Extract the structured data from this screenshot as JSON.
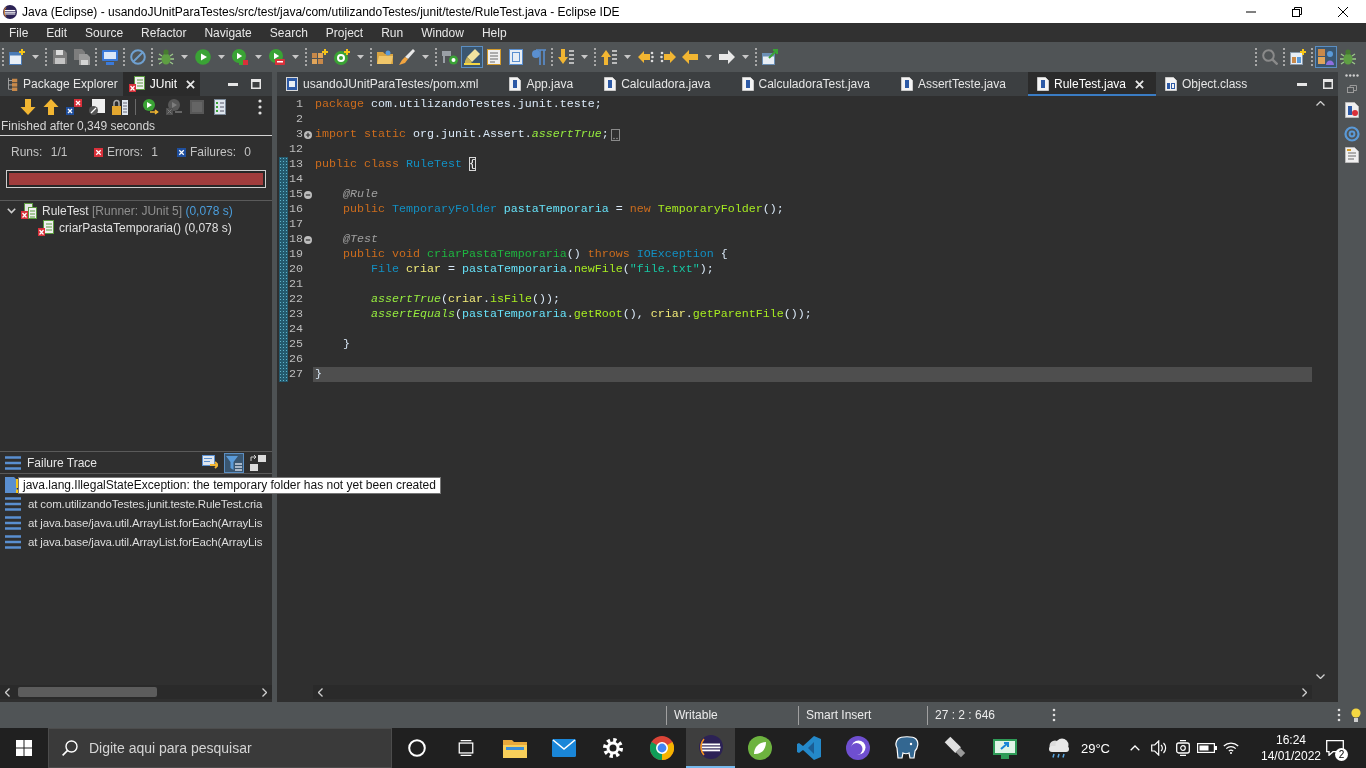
{
  "window": {
    "title": "Java (Eclipse) - usandoJUnitParaTestes/src/test/java/com/utilizandoTestes/junit/teste/RuleTest.java - Eclipse IDE"
  },
  "menu": [
    "File",
    "Edit",
    "Source",
    "Refactor",
    "Navigate",
    "Search",
    "Project",
    "Run",
    "Window",
    "Help"
  ],
  "toolbar": {
    "groups": [
      {
        "items": [
          {
            "kind": "new-wizard",
            "dropdown": true,
            "pressed": false
          }
        ]
      },
      {
        "items": [
          {
            "kind": "save",
            "dropdown": false,
            "pressed": false
          },
          {
            "kind": "save-all",
            "dropdown": false,
            "pressed": false
          }
        ]
      },
      {
        "items": [
          {
            "kind": "terminal",
            "dropdown": false,
            "pressed": false
          }
        ]
      },
      {
        "items": [
          {
            "kind": "skip-breakpoints",
            "dropdown": false,
            "pressed": false
          }
        ]
      },
      {
        "items": [
          {
            "kind": "debug",
            "dropdown": true,
            "pressed": false
          },
          {
            "kind": "run",
            "dropdown": true,
            "pressed": false
          },
          {
            "kind": "coverage",
            "dropdown": true,
            "pressed": false
          },
          {
            "kind": "external-tools",
            "dropdown": true,
            "pressed": false
          }
        ]
      },
      {
        "items": [
          {
            "kind": "new-package",
            "dropdown": false,
            "pressed": false
          },
          {
            "kind": "new-class",
            "dropdown": true,
            "pressed": false
          }
        ]
      },
      {
        "items": [
          {
            "kind": "open-type",
            "dropdown": false,
            "pressed": false
          },
          {
            "kind": "brush",
            "dropdown": true,
            "pressed": false
          }
        ]
      },
      {
        "items": [
          {
            "kind": "breadcrumb",
            "dropdown": false,
            "pressed": false
          },
          {
            "kind": "highlight",
            "dropdown": false,
            "pressed": true
          },
          {
            "kind": "block-selection",
            "dropdown": false,
            "pressed": false
          },
          {
            "kind": "show-whitespace",
            "dropdown": false,
            "pressed": false
          },
          {
            "kind": "pilcrow",
            "dropdown": false,
            "pressed": false
          }
        ]
      },
      {
        "items": [
          {
            "kind": "next-annotation",
            "dropdown": true,
            "pressed": false
          }
        ]
      },
      {
        "items": [
          {
            "kind": "previous-annotation",
            "dropdown": true,
            "pressed": false
          },
          {
            "kind": "last-edit",
            "dropdown": false,
            "pressed": false
          },
          {
            "kind": "next-edit",
            "dropdown": false,
            "pressed": false
          },
          {
            "kind": "back",
            "dropdown": true,
            "pressed": false
          },
          {
            "kind": "forward",
            "dropdown": true,
            "pressed": false
          }
        ]
      },
      {
        "items": [
          {
            "kind": "launch",
            "dropdown": false,
            "pressed": false
          }
        ]
      }
    ],
    "right_groups": [
      {
        "items": [
          {
            "kind": "search",
            "dropdown": false,
            "pressed": false
          }
        ]
      },
      {
        "items": [
          {
            "kind": "open-perspective",
            "dropdown": false,
            "pressed": false
          }
        ]
      },
      {
        "items": [
          {
            "kind": "java-perspective",
            "dropdown": false,
            "pressed": true
          },
          {
            "kind": "debug-perspective",
            "dropdown": false,
            "pressed": false
          }
        ]
      }
    ]
  },
  "left_panel": {
    "tabs": [
      {
        "label": "Package Explorer",
        "kind": "explorer",
        "selected": false
      },
      {
        "label": "JUnit",
        "kind": "junit",
        "selected": true
      }
    ],
    "toolbar": {
      "groups": [
        {
          "items": [
            {
              "kind": "next-failure",
              "disabled": false
            },
            {
              "kind": "previous-failure",
              "disabled": false
            },
            {
              "kind": "failures-only",
              "disabled": false
            },
            {
              "kind": "skipped-filter",
              "disabled": false
            },
            {
              "kind": "scroll-lock",
              "disabled": false
            }
          ]
        },
        {
          "items": [
            {
              "kind": "rerun",
              "disabled": false
            },
            {
              "kind": "rerun-failed",
              "disabled": true
            },
            {
              "kind": "stop",
              "disabled": true
            },
            {
              "kind": "history",
              "disabled": false
            }
          ]
        },
        {
          "items": [
            {
              "kind": "view-menu",
              "disabled": false
            }
          ]
        }
      ]
    },
    "status": "Finished after 0,349 seconds",
    "counters": [
      {
        "kind": "runs",
        "label": "Runs:",
        "value": "1/1"
      },
      {
        "kind": "errors",
        "label": "Errors:",
        "value": "1"
      },
      {
        "kind": "failures",
        "label": "Failures:",
        "value": "0"
      }
    ],
    "progress": {
      "level": 1,
      "failed": true
    },
    "tests": [
      {
        "kind": "suite",
        "name": "RuleTest",
        "runner": "[Runner: JUnit 5]",
        "time": "(0,078 s)",
        "failed": true,
        "expanded": true,
        "children": [
          {
            "kind": "test",
            "name": "criarPastaTemporaria()",
            "time": "(0,078 s)",
            "failed": true
          }
        ]
      }
    ],
    "failure_trace": {
      "title": "Failure Trace",
      "tools": [
        {
          "kind": "compare",
          "pressed": false
        },
        {
          "kind": "filter",
          "pressed": true
        },
        {
          "kind": "layout",
          "pressed": false
        }
      ],
      "lines": [
        {
          "kind": "exception"
        },
        {
          "kind": "frame",
          "text": "at com.utilizandoTestes.junit.teste.RuleTest.cria"
        },
        {
          "kind": "frame",
          "text": "at java.base/java.util.ArrayList.forEach(ArrayLis"
        },
        {
          "kind": "frame",
          "text": "at java.base/java.util.ArrayList.forEach(ArrayLis"
        }
      ]
    },
    "tooltip": "java.lang.IllegalStateException: the temporary folder has not yet been created"
  },
  "editor": {
    "tabs": [
      {
        "label": "usandoJUnitParaTestes/pom.xml",
        "kind": "maven",
        "selected": false
      },
      {
        "label": "App.java",
        "kind": "java",
        "selected": false
      },
      {
        "label": "Calculadora.java",
        "kind": "java",
        "selected": false
      },
      {
        "label": "CalculadoraTest.java",
        "kind": "java",
        "selected": false
      },
      {
        "label": "AssertTeste.java",
        "kind": "java",
        "selected": false
      },
      {
        "label": "RuleTest.java",
        "kind": "java",
        "selected": true
      },
      {
        "label": "Object.class",
        "kind": "class",
        "selected": false
      }
    ],
    "lines": [
      {
        "number": "1",
        "fold_start": false,
        "changed": false,
        "current": false,
        "tokens": [
          {
            "kind": "keyword",
            "text": "package"
          },
          {
            "kind": "plain",
            "text": " com.utilizandoTestes.junit.teste;"
          }
        ]
      },
      {
        "number": "2",
        "fold_start": false,
        "changed": false,
        "current": false
      },
      {
        "number": "3",
        "fold_start": true,
        "collapsed": true,
        "changed": false,
        "current": false,
        "tokens": [
          {
            "kind": "keyword",
            "text": "import static"
          },
          {
            "kind": "plain",
            "text": " org.junit.Assert."
          },
          {
            "kind": "static",
            "text": "assertTrue"
          },
          {
            "kind": "plain",
            "text": ";"
          }
        ]
      },
      {
        "number": "12",
        "fold_start": false,
        "changed": false,
        "current": false
      },
      {
        "number": "13",
        "fold_start": false,
        "changed": true,
        "current": false,
        "tokens": [
          {
            "kind": "keyword",
            "text": "public class"
          },
          {
            "kind": "type",
            "text": " RuleTest "
          },
          {
            "kind": "bracket-match",
            "text": "{"
          }
        ]
      },
      {
        "number": "14",
        "fold_start": false,
        "changed": true,
        "current": false
      },
      {
        "number": "15",
        "fold_start": true,
        "collapsed": false,
        "changed": true,
        "current": false,
        "tokens": [
          {
            "kind": "annotation",
            "text": "    @Rule"
          }
        ]
      },
      {
        "number": "16",
        "fold_start": false,
        "changed": true,
        "current": false,
        "tokens": [
          {
            "kind": "keyword",
            "text": "    public"
          },
          {
            "kind": "type",
            "text": " TemporaryFolder"
          },
          {
            "kind": "field",
            "text": " pastaTemporaria"
          },
          {
            "kind": "plain",
            "text": " = "
          },
          {
            "kind": "keyword",
            "text": "new"
          },
          {
            "kind": "method",
            "text": " TemporaryFolder"
          },
          {
            "kind": "plain",
            "text": "();"
          }
        ]
      },
      {
        "number": "17",
        "fold_start": false,
        "changed": true,
        "current": false
      },
      {
        "number": "18",
        "fold_start": true,
        "collapsed": false,
        "changed": true,
        "current": false,
        "tokens": [
          {
            "kind": "annotation",
            "text": "    @Test"
          }
        ]
      },
      {
        "number": "19",
        "fold_start": false,
        "changed": true,
        "current": false,
        "tokens": [
          {
            "kind": "keyword",
            "text": "    public void"
          },
          {
            "kind": "method-decl",
            "text": " criarPastaTemporaria"
          },
          {
            "kind": "plain",
            "text": "() "
          },
          {
            "kind": "keyword",
            "text": "throws"
          },
          {
            "kind": "type",
            "text": " IOException"
          },
          {
            "kind": "plain",
            "text": " {"
          }
        ]
      },
      {
        "number": "20",
        "fold_start": false,
        "changed": true,
        "current": false,
        "tokens": [
          {
            "kind": "type",
            "text": "        File"
          },
          {
            "kind": "local",
            "text": " criar"
          },
          {
            "kind": "plain",
            "text": " = "
          },
          {
            "kind": "field",
            "text": "pastaTemporaria"
          },
          {
            "kind": "plain",
            "text": "."
          },
          {
            "kind": "method",
            "text": "newFile"
          },
          {
            "kind": "plain",
            "text": "("
          },
          {
            "kind": "string",
            "text": "\"file.txt\""
          },
          {
            "kind": "plain",
            "text": ");"
          }
        ]
      },
      {
        "number": "21",
        "fold_start": false,
        "changed": true,
        "current": false
      },
      {
        "number": "22",
        "fold_start": false,
        "changed": true,
        "current": false,
        "tokens": [
          {
            "kind": "static",
            "text": "        assertTrue"
          },
          {
            "kind": "plain",
            "text": "("
          },
          {
            "kind": "local",
            "text": "criar"
          },
          {
            "kind": "plain",
            "text": "."
          },
          {
            "kind": "method",
            "text": "isFile"
          },
          {
            "kind": "plain",
            "text": "());"
          }
        ]
      },
      {
        "number": "23",
        "fold_start": false,
        "changed": true,
        "current": false,
        "tokens": [
          {
            "kind": "static",
            "text": "        assertEquals"
          },
          {
            "kind": "plain",
            "text": "("
          },
          {
            "kind": "field",
            "text": "pastaTemporaria"
          },
          {
            "kind": "plain",
            "text": "."
          },
          {
            "kind": "method",
            "text": "getRoot"
          },
          {
            "kind": "plain",
            "text": "(), "
          },
          {
            "kind": "local",
            "text": "criar"
          },
          {
            "kind": "plain",
            "text": "."
          },
          {
            "kind": "method",
            "text": "getParentFile"
          },
          {
            "kind": "plain",
            "text": "());"
          }
        ]
      },
      {
        "number": "24",
        "fold_start": false,
        "changed": true,
        "current": false
      },
      {
        "number": "25",
        "fold_start": false,
        "changed": true,
        "current": false,
        "tokens": [
          {
            "kind": "plain",
            "text": "    }"
          }
        ]
      },
      {
        "number": "26",
        "fold_start": false,
        "changed": true,
        "current": false
      },
      {
        "number": "27",
        "fold_start": false,
        "changed": true,
        "current": true,
        "tokens": [
          {
            "kind": "plain",
            "text": "}"
          }
        ]
      }
    ]
  },
  "status_bar": {
    "fields": [
      "Writable",
      "Smart Insert",
      "27 : 2 : 646"
    ]
  },
  "taskbar": {
    "search": {
      "placeholder": "Digite aqui para pesquisar"
    },
    "apps": [
      {
        "kind": "ring",
        "selected": false
      },
      {
        "kind": "task-view",
        "selected": false
      },
      {
        "kind": "folder",
        "selected": false
      },
      {
        "kind": "envelope",
        "selected": false
      },
      {
        "kind": "gear",
        "selected": false
      },
      {
        "kind": "tricolor",
        "selected": false
      },
      {
        "kind": "striped",
        "selected": true
      },
      {
        "kind": "leaf",
        "selected": false
      },
      {
        "kind": "ribbon",
        "selected": false
      },
      {
        "kind": "crescent",
        "selected": false
      },
      {
        "kind": "elephant",
        "selected": false
      },
      {
        "kind": "usb",
        "selected": false
      },
      {
        "kind": "monitor",
        "selected": false
      }
    ],
    "weather": "29°C",
    "time": "16:24",
    "date": "14/01/2022",
    "notifications": "2"
  }
}
